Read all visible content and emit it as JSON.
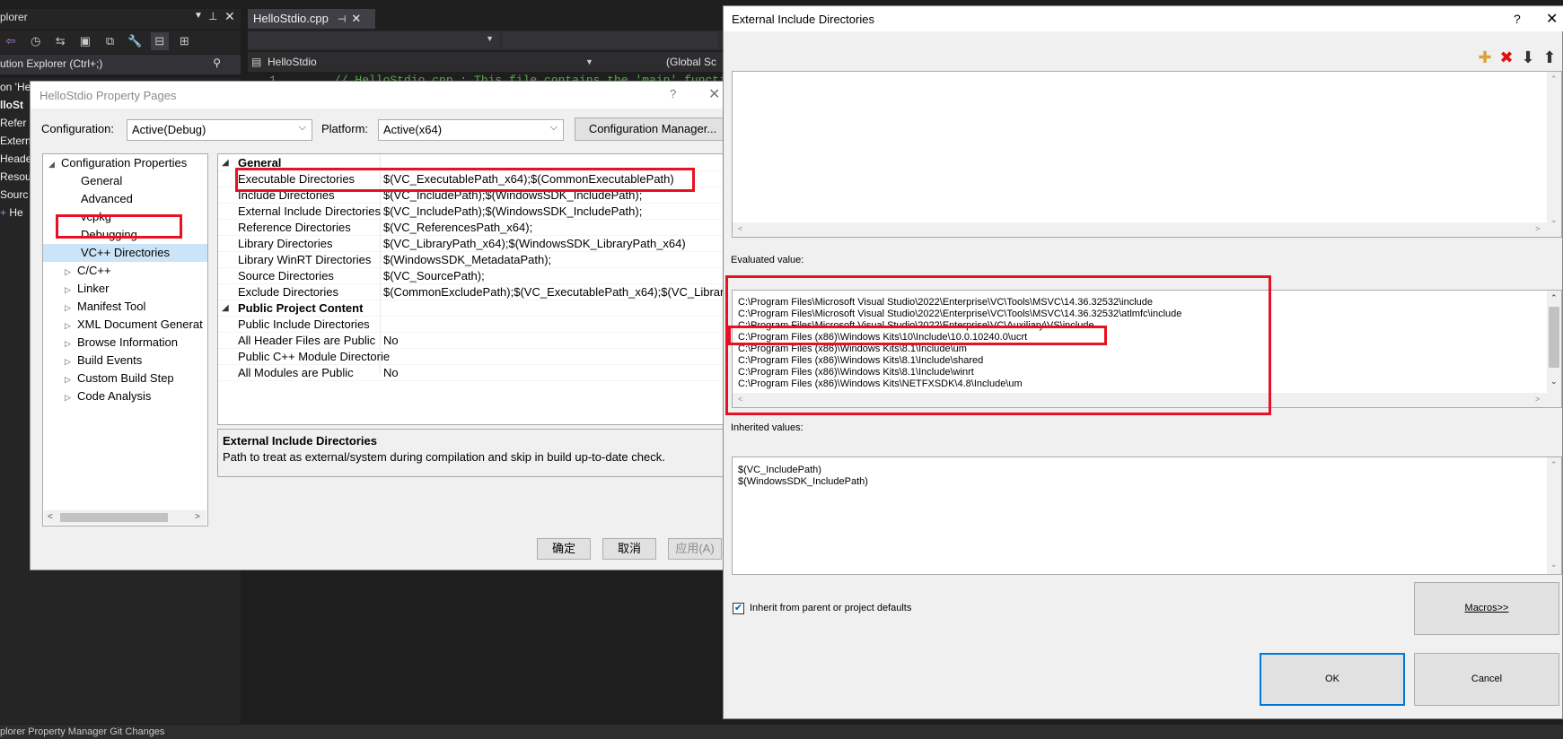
{
  "solution_explorer": {
    "title": "plorer",
    "search_placeholder": "ution Explorer (Ctrl+;)",
    "tree": [
      "on 'He",
      "lloSt",
      "Refer",
      "Extern",
      "Heade",
      "Resou",
      "Sourc",
      "He"
    ],
    "bottom_tabs": "plorer   Property Manager   Git Changes"
  },
  "editor": {
    "tab_label": "HelloStdio.cpp",
    "pin_glyph": "⊣",
    "nav_project": "HelloStdio",
    "nav_scope": "(Global Sc",
    "line_number": "1",
    "code_line": "// HelloStdio.cpp : This file contains the 'main' functio"
  },
  "property_pages": {
    "title": "HelloStdio Property Pages",
    "help": "?",
    "close": "X",
    "configuration_label": "Configuration:",
    "configuration_value": "Active(Debug)",
    "platform_label": "Platform:",
    "platform_value": "Active(x64)",
    "config_manager_button": "Configuration Manager...",
    "nav": [
      {
        "label": "Configuration Properties",
        "expanded": true,
        "level": 0
      },
      {
        "label": "General",
        "level": 1
      },
      {
        "label": "Advanced",
        "level": 1
      },
      {
        "label": "vcpkg",
        "level": 1
      },
      {
        "label": "Debugging",
        "level": 1
      },
      {
        "label": "VC++ Directories",
        "level": 1,
        "selected": true
      },
      {
        "label": "C/C++",
        "level": 1,
        "collapsible": true
      },
      {
        "label": "Linker",
        "level": 1,
        "collapsible": true
      },
      {
        "label": "Manifest Tool",
        "level": 1,
        "collapsible": true
      },
      {
        "label": "XML Document Generat",
        "level": 1,
        "collapsible": true
      },
      {
        "label": "Browse Information",
        "level": 1,
        "collapsible": true
      },
      {
        "label": "Build Events",
        "level": 1,
        "collapsible": true
      },
      {
        "label": "Custom Build Step",
        "level": 1,
        "collapsible": true
      },
      {
        "label": "Code Analysis",
        "level": 1,
        "collapsible": true
      }
    ],
    "grid": {
      "section_general": "General",
      "rows_general": [
        {
          "name": "Executable Directories",
          "value": "$(VC_ExecutablePath_x64);$(CommonExecutablePath)"
        },
        {
          "name": "Include Directories",
          "value": "$(VC_IncludePath);$(WindowsSDK_IncludePath);"
        },
        {
          "name": "External Include Directories",
          "value": "$(VC_IncludePath);$(WindowsSDK_IncludePath);"
        },
        {
          "name": "Reference Directories",
          "value": "$(VC_ReferencesPath_x64);"
        },
        {
          "name": "Library Directories",
          "value": "$(VC_LibraryPath_x64);$(WindowsSDK_LibraryPath_x64)"
        },
        {
          "name": "Library WinRT Directories",
          "value": "$(WindowsSDK_MetadataPath);"
        },
        {
          "name": "Source Directories",
          "value": "$(VC_SourcePath);"
        },
        {
          "name": "Exclude Directories",
          "value": "$(CommonExcludePath);$(VC_ExecutablePath_x64);$(VC_Librar"
        }
      ],
      "section_public": "Public Project Content",
      "rows_public": [
        {
          "name": "Public Include Directories",
          "value": ""
        },
        {
          "name": "All Header Files are Public",
          "value": "No"
        },
        {
          "name": "Public C++ Module Directorie",
          "value": ""
        },
        {
          "name": "All Modules are Public",
          "value": "No"
        }
      ]
    },
    "description_title": "External Include Directories",
    "description_text": "Path to treat as external/system during compilation and skip in build up-to-date check.",
    "ok": "确定",
    "cancel": "取消",
    "apply": "应用(A)"
  },
  "external_include_dialog": {
    "title": "External Include Directories",
    "help": "?",
    "close": "X",
    "toolbar_icons": [
      "new-line-icon",
      "delete-icon",
      "move-down-icon",
      "move-up-icon"
    ],
    "evaluated_label": "Evaluated value:",
    "evaluated_lines": [
      "C:\\Program Files\\Microsoft Visual Studio\\2022\\Enterprise\\VC\\Tools\\MSVC\\14.36.32532\\include",
      "C:\\Program Files\\Microsoft Visual Studio\\2022\\Enterprise\\VC\\Tools\\MSVC\\14.36.32532\\atlmfc\\include",
      "C:\\Program Files\\Microsoft Visual Studio\\2022\\Enterprise\\VC\\Auxiliary\\VS\\include",
      "C:\\Program Files (x86)\\Windows Kits\\10\\Include\\10.0.10240.0\\ucrt",
      "C:\\Program Files (x86)\\Windows Kits\\8.1\\Include\\um",
      "C:\\Program Files (x86)\\Windows Kits\\8.1\\Include\\shared",
      "C:\\Program Files (x86)\\Windows Kits\\8.1\\Include\\winrt",
      "C:\\Program Files (x86)\\Windows Kits\\NETFXSDK\\4.8\\Include\\um"
    ],
    "inherited_label": "Inherited values:",
    "inherited_lines": [
      "$(VC_IncludePath)",
      "$(WindowsSDK_IncludePath)"
    ],
    "inherit_checkbox_label": "Inherit from parent or project defaults",
    "inherit_checked": true,
    "macros_button": "Macros>>",
    "ok": "OK",
    "cancel": "Cancel"
  }
}
